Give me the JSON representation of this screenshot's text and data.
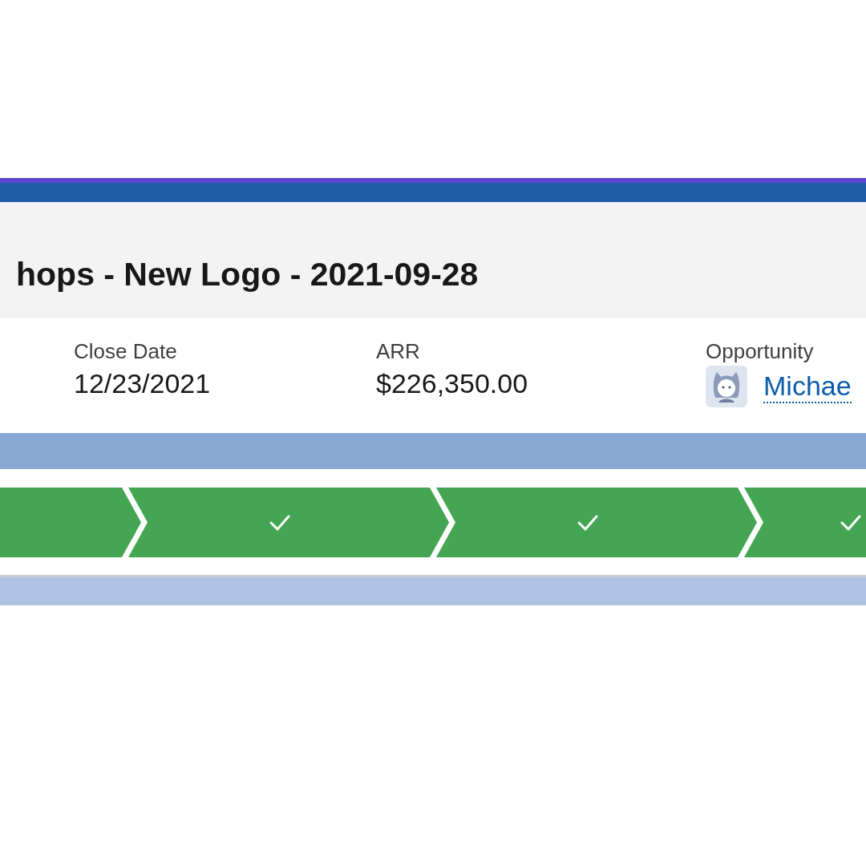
{
  "header": {
    "title": "hops - New Logo - 2021-09-28"
  },
  "highlights": [
    {
      "kind": "text",
      "label": "Close Date",
      "value": "12/23/2021"
    },
    {
      "kind": "text",
      "label": "ARR",
      "value": "$226,350.00"
    },
    {
      "kind": "user",
      "label": "Opportunity",
      "value": "Michae"
    }
  ],
  "path": {
    "steps": [
      {
        "kind": "tail",
        "completed": true
      },
      {
        "kind": "stage",
        "completed": true
      },
      {
        "kind": "stage",
        "completed": true
      },
      {
        "kind": "stage",
        "completed": true
      }
    ]
  }
}
